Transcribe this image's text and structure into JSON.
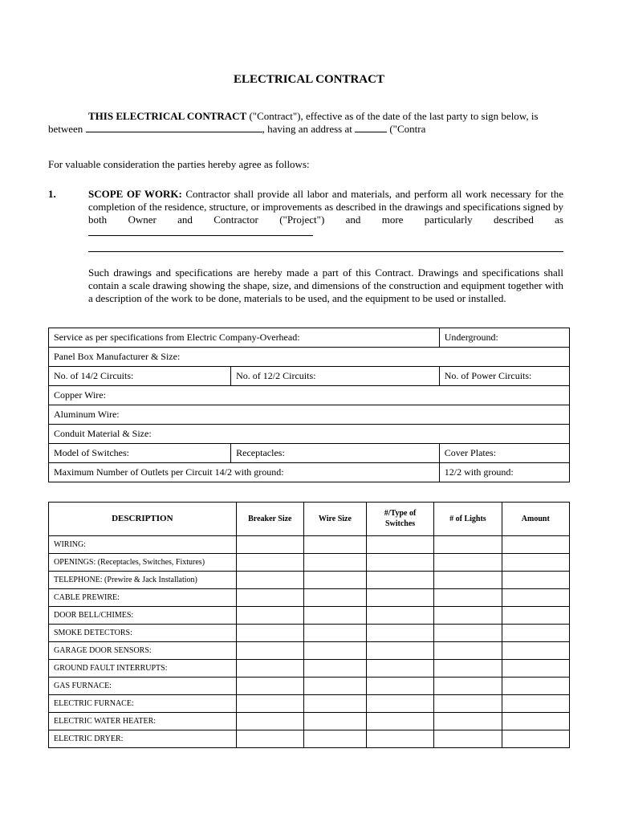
{
  "title": "ELECTRICAL CONTRACT",
  "intro": {
    "lead": "THIS ELECTRICAL CONTRACT",
    "afterLead": " (\"Contract\"), effective as of the date of the last party to sign below, is between ",
    "addressText": ", having an address at ",
    "afterAddress": " (\"Contra"
  },
  "consideration": "For valuable consideration the parties hereby agree as follows:",
  "section1": {
    "num": "1.",
    "heading": "SCOPE OF WORK:",
    "body": " Contractor shall provide all labor and materials, and perform all work necessary for the completion of the residence, structure, or improvements as described in the drawings and specifications signed by both Owner and Contractor (\"Project\") and more particularly described as "
  },
  "para2": "Such drawings and specifications are hereby made a part of this Contract. Drawings and specifications shall contain a scale drawing showing the shape, size, and dimensions of the construction and equipment together with a description of the work to be done, materials to be used, and the equipment to be used or installed.",
  "spec": {
    "r1c1": "Service as per specifications from Electric Company-Overhead:",
    "r1c2": "Underground:",
    "r2c1": "Panel Box Manufacturer & Size:",
    "r3c1": "No. of 14/2 Circuits:",
    "r3c2": "No. of 12/2 Circuits:",
    "r3c3": "No. of Power Circuits:",
    "r4c1": "Copper Wire:",
    "r5c1": "Aluminum Wire:",
    "r6c1": "Conduit Material & Size:",
    "r7c1": "Model of Switches:",
    "r7c2": "Receptacles:",
    "r7c3": "Cover Plates:",
    "r8c1": "Maximum Number of Outlets per Circuit 14/2 with ground:",
    "r8c2": "12/2 with ground:"
  },
  "descTable": {
    "headers": {
      "desc": "DESCRIPTION",
      "breaker": "Breaker Size",
      "wire": "Wire Size",
      "switches": "#/Type of Switches",
      "lights": "# of Lights",
      "amount": "Amount"
    },
    "rows": [
      "WIRING:",
      "OPENINGS: (Receptacles, Switches, Fixtures)",
      "TELEPHONE: (Prewire & Jack Installation)",
      "CABLE PREWIRE:",
      "DOOR BELL/CHIMES:",
      "SMOKE DETECTORS:",
      "GARAGE DOOR SENSORS:",
      "GROUND FAULT INTERRUPTS:",
      "GAS FURNACE:",
      "ELECTRIC FURNACE:",
      "ELECTRIC WATER HEATER:",
      "ELECTRIC DRYER:"
    ]
  }
}
